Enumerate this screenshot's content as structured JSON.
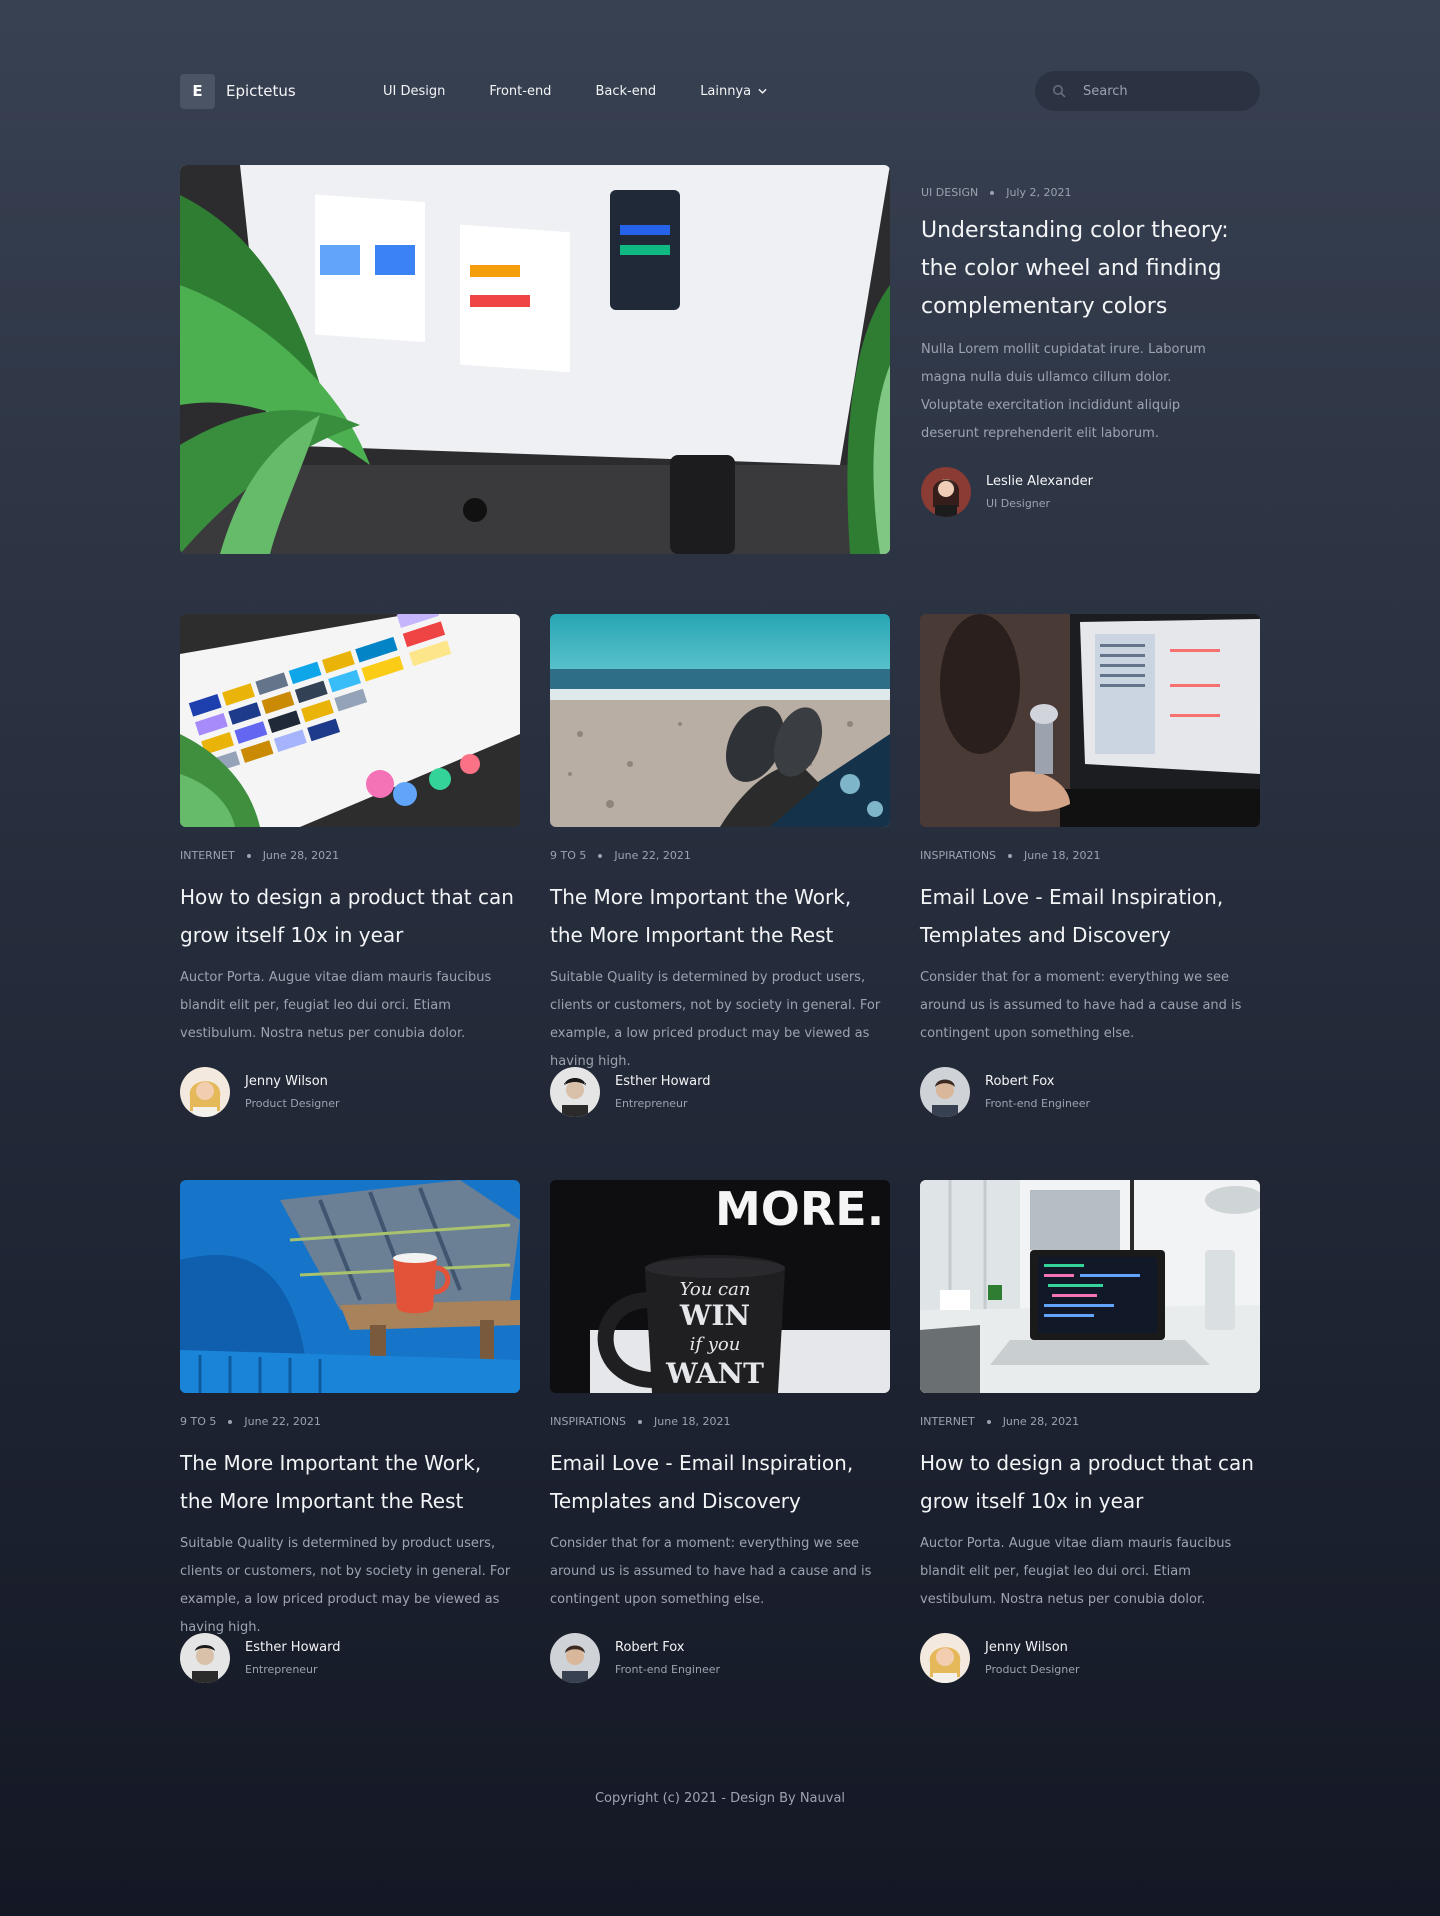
{
  "brand": {
    "logo_letter": "E",
    "name": "Epictetus"
  },
  "nav": {
    "items": [
      "UI Design",
      "Front-end",
      "Back-end"
    ],
    "more_label": "Lainnya"
  },
  "search": {
    "placeholder": "Search",
    "icon": "search-icon"
  },
  "featured": {
    "category": "UI DESIGN",
    "date": "July 2, 2021",
    "title": "Understanding color theory: the color wheel and finding complementary colors",
    "excerpt": "Nulla Lorem mollit cupidatat irure. Laborum magna nulla duis ullamco cillum dolor. Voluptate exercitation incididunt aliquip deserunt reprehenderit elit laborum.",
    "author": {
      "name": "Leslie Alexander",
      "role": "UI Designer"
    },
    "image": "Desktop monitor showing Widget Templates and Component Library design screens with plants"
  },
  "posts": [
    {
      "category": "INTERNET",
      "date": "June 28, 2021",
      "title": "How to design a product that can grow itself 10x in year",
      "excerpt": "Auctor Porta. Augue vitae diam mauris faucibus blandit elit per, feugiat leo dui orci. Etiam vestibulum. Nostra netus per conubia dolor.",
      "author": {
        "name": "Jenny Wilson",
        "role": "Product Designer"
      },
      "image": "Color swatch palette on desk"
    },
    {
      "category": "9 TO 5",
      "date": "June 22, 2021",
      "title": "The More Important the Work, the More Important the Rest",
      "excerpt": "Suitable Quality is determined by product users, clients or customers, not by society in general. For example, a low priced product may be viewed as having high.",
      "author": {
        "name": "Esther Howard",
        "role": "Entrepreneur"
      },
      "image": "Boots on a pebble beach by the sea"
    },
    {
      "category": "INSPIRATIONS",
      "date": "June 18, 2021",
      "title": "Email Love - Email Inspiration, Templates and Discovery",
      "excerpt": "Consider that for a moment: everything we see around us is assumed to have had a cause and is contingent upon something else.",
      "author": {
        "name": "Robert Fox",
        "role": "Front-end Engineer"
      },
      "image": "Person working on a laptop"
    },
    {
      "category": "9 TO 5",
      "date": "June 22, 2021",
      "title": "The More Important the Work, the More Important the Rest",
      "excerpt": "Suitable Quality is determined by product users, clients or customers, not by society in general. For example, a low priced product may be viewed as having high.",
      "author": {
        "name": "Esther Howard",
        "role": "Entrepreneur"
      },
      "image": "Red mug on a table by a blue sofa"
    },
    {
      "category": "INSPIRATIONS",
      "date": "June 18, 2021",
      "title": "Email Love - Email Inspiration, Templates and Discovery",
      "excerpt": "Consider that for a moment: everything we see around us is assumed to have had a cause and is contingent upon something else.",
      "author": {
        "name": "Robert Fox",
        "role": "Front-end Engineer"
      },
      "image": "Black mug reading You can WIN if you WANT",
      "image_text": {
        "top": "MORE.",
        "mug_line1": "You can",
        "mug_line2": "WIN",
        "mug_line3": "if you",
        "mug_line4": "WANT"
      }
    },
    {
      "category": "INTERNET",
      "date": "June 28, 2021",
      "title": "How to design a product that can grow itself 10x in year",
      "excerpt": "Auctor Porta. Augue vitae diam mauris faucibus blandit elit per, feugiat leo dui orci. Etiam vestibulum. Nostra netus per conubia dolor.",
      "author": {
        "name": "Jenny Wilson",
        "role": "Product Designer"
      },
      "image": "Laptop with code on a white desk"
    }
  ],
  "footer": {
    "text": "Copyright (c) 2021 - Design By Nauval"
  },
  "colors": {
    "bg_top": "#384152",
    "bg_bottom": "#141825",
    "text": "#f3f4f6",
    "muted": "#9ca3af"
  }
}
